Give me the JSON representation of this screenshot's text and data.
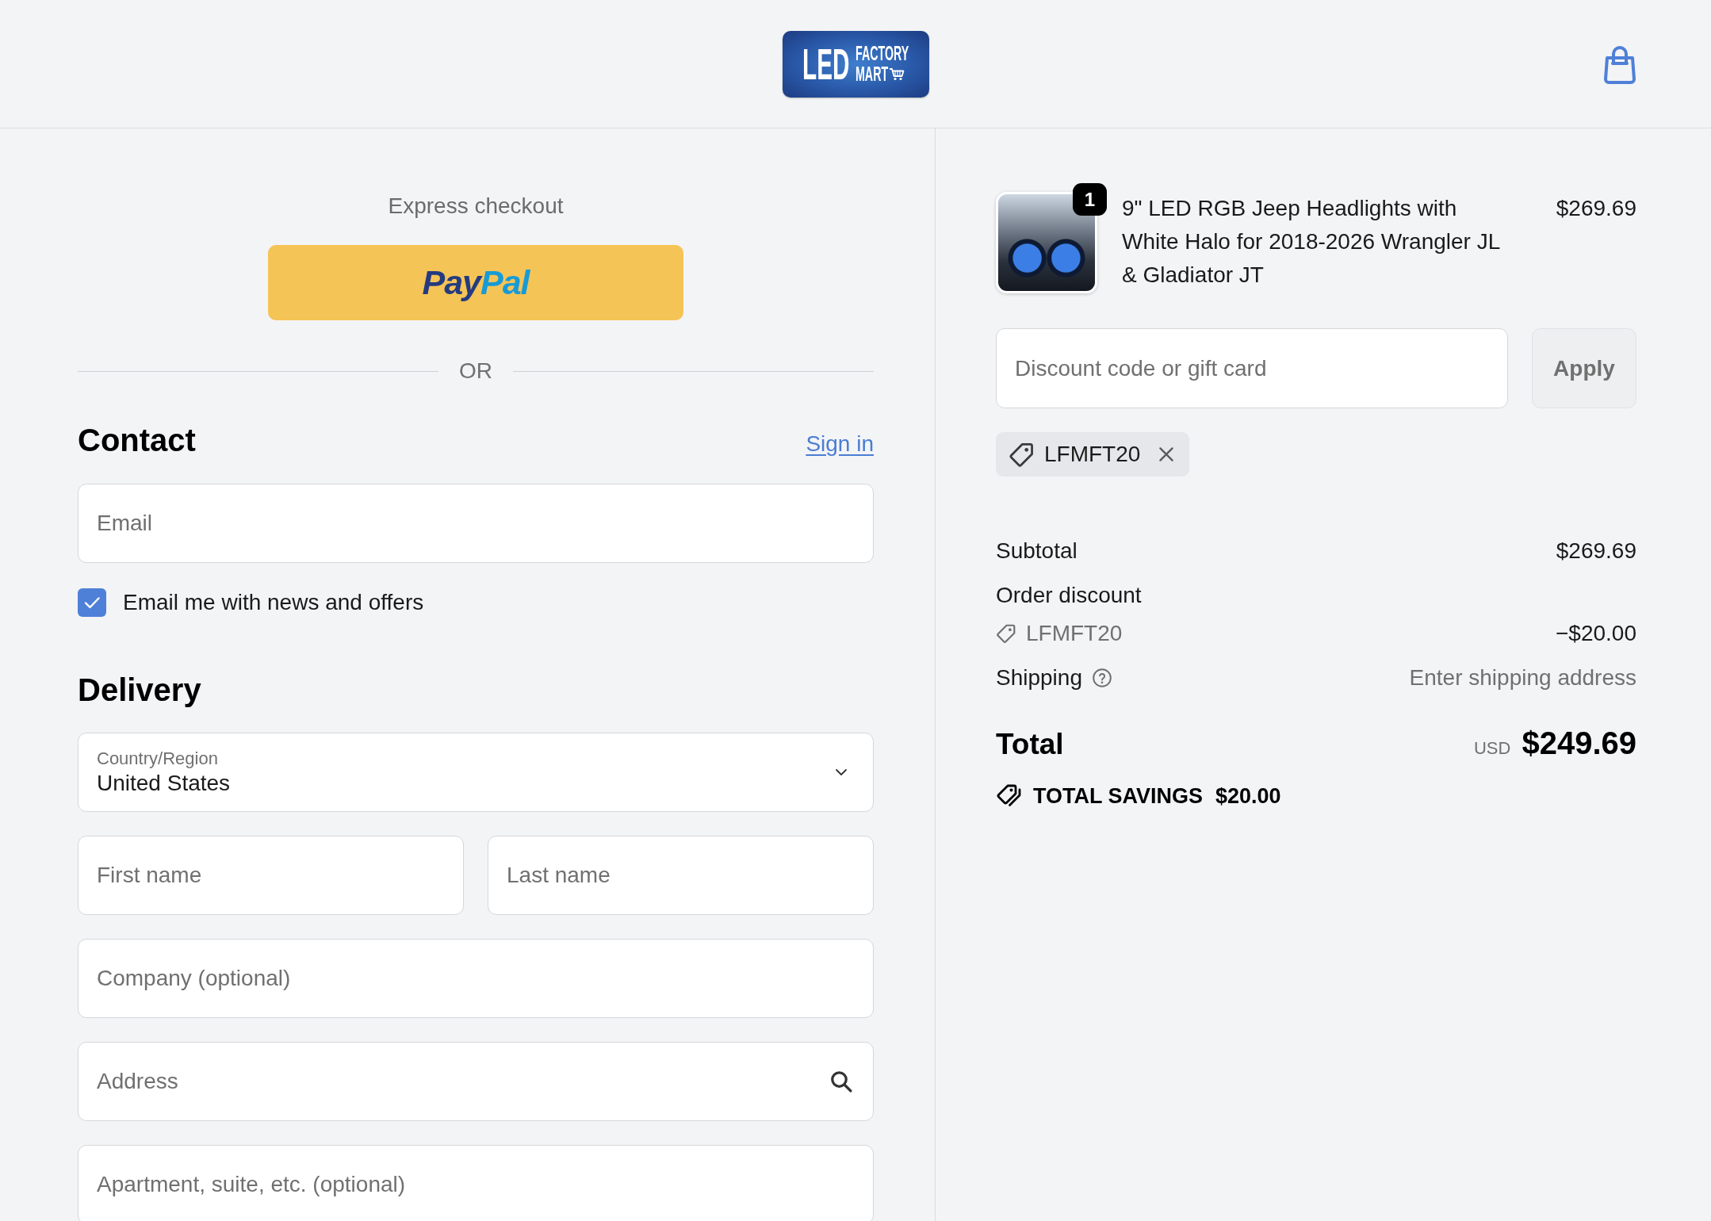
{
  "header": {
    "logo": {
      "wordmark": "LED",
      "lines": [
        "FACTORY",
        "MART"
      ]
    }
  },
  "checkout": {
    "express": {
      "title": "Express checkout",
      "wallets": [
        {
          "kind": "paypal",
          "label_parts": [
            "Pay",
            "Pal"
          ]
        }
      ]
    },
    "separator": "OR",
    "contact": {
      "heading": "Contact",
      "link": "Sign in",
      "fields": [
        {
          "kind": "text",
          "placeholder": "Email"
        }
      ],
      "newsletter": {
        "label": "Email me with news and offers",
        "checked": true
      }
    },
    "delivery": {
      "heading": "Delivery",
      "rows": [
        {
          "fields": [
            {
              "kind": "select",
              "label": "Country/Region",
              "value": "United States"
            }
          ]
        },
        {
          "fields": [
            {
              "kind": "text",
              "placeholder": "First name"
            },
            {
              "kind": "text",
              "placeholder": "Last name"
            }
          ]
        },
        {
          "fields": [
            {
              "kind": "text",
              "placeholder": "Company (optional)"
            }
          ]
        },
        {
          "fields": [
            {
              "kind": "search",
              "placeholder": "Address"
            }
          ]
        },
        {
          "fields": [
            {
              "kind": "text",
              "placeholder": "Apartment, suite, etc. (optional)"
            }
          ]
        }
      ]
    }
  },
  "summary": {
    "items": [
      {
        "title": "9\" LED RGB Jeep Headlights with White Halo for 2018-2026 Wrangler JL & Gladiator JT",
        "quantity": "1",
        "price": "$269.69"
      }
    ],
    "discount": {
      "placeholder": "Discount code or gift card",
      "button": "Apply",
      "disabled": true
    },
    "applied_codes": [
      {
        "code": "LFMFT20"
      }
    ],
    "lines": [
      {
        "kind": "plain",
        "label": "Subtotal",
        "value": "$269.69"
      },
      {
        "kind": "discount",
        "label": "Order discount",
        "code": "LFMFT20",
        "value": "−$20.00"
      },
      {
        "kind": "help",
        "label": "Shipping",
        "value": "Enter shipping address"
      }
    ],
    "total": {
      "label": "Total",
      "currency": "USD",
      "value": "$249.69"
    },
    "savings": {
      "label": "TOTAL SAVINGS",
      "value": "$20.00"
    }
  }
}
